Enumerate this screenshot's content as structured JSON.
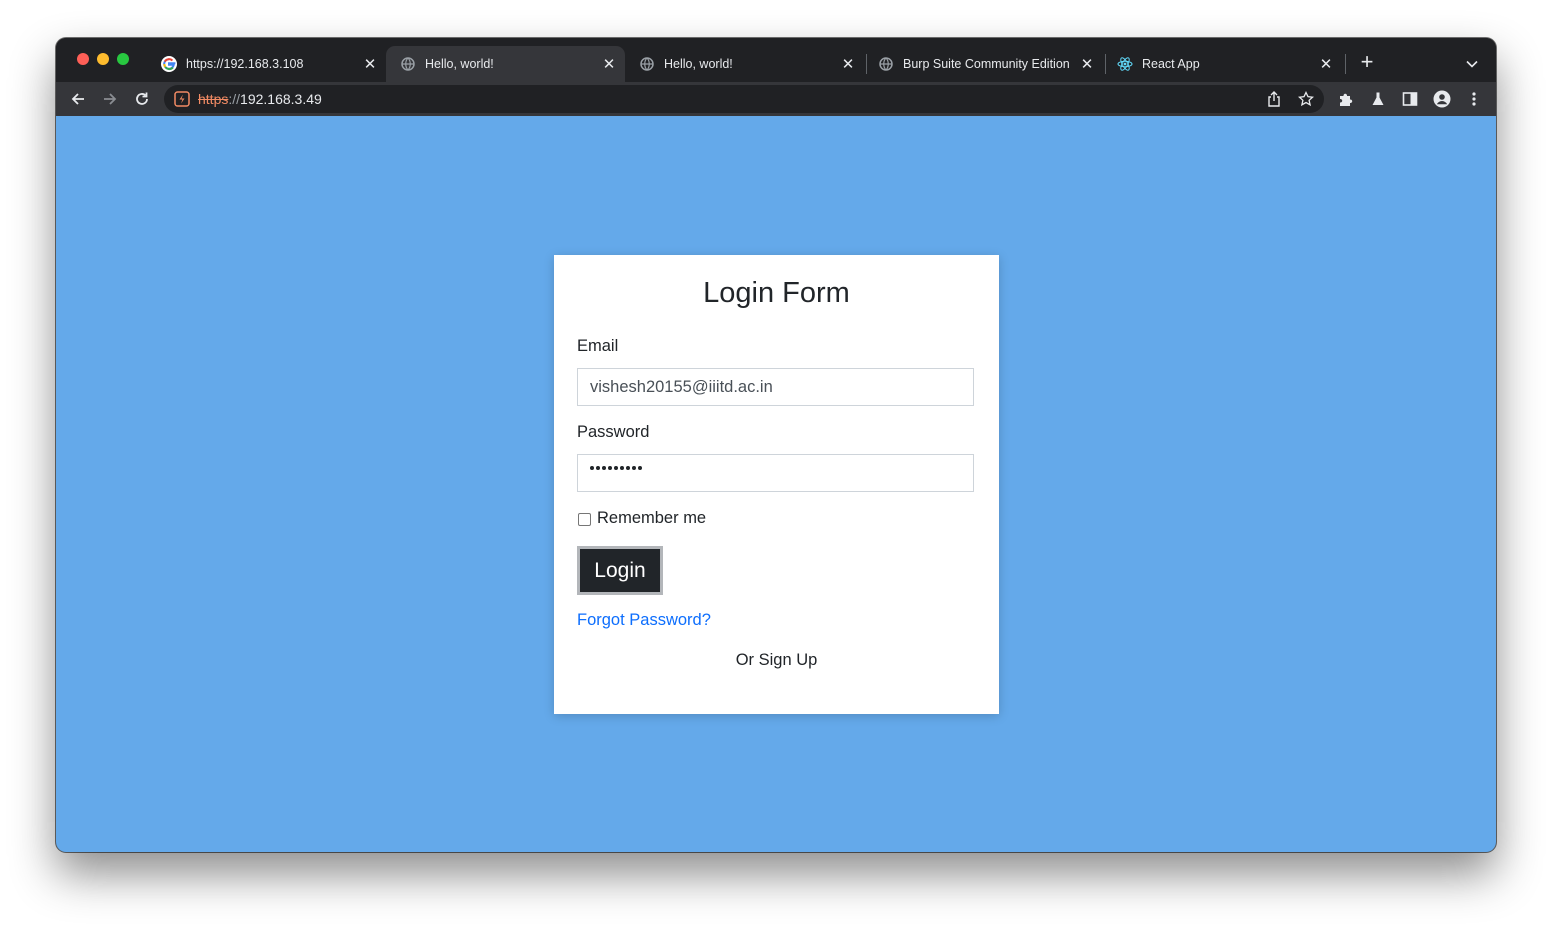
{
  "browser": {
    "tabs": [
      {
        "title": "https://192.168.3.108",
        "icon": "google-icon",
        "active": false
      },
      {
        "title": "Hello, world!",
        "icon": "globe-icon",
        "active": true
      },
      {
        "title": "Hello, world!",
        "icon": "globe-icon",
        "active": false
      },
      {
        "title": "Burp Suite Community Edition",
        "icon": "globe-icon",
        "active": false
      },
      {
        "title": "React App",
        "icon": "react-icon",
        "active": false
      }
    ],
    "address_bar": {
      "scheme": "https",
      "separator": "://",
      "host": "192.168.3.49",
      "security": "not-secure"
    },
    "colors": {
      "accent": "#f28b64",
      "page_background": "#64a9ea"
    }
  },
  "login_form": {
    "title": "Login Form",
    "email_label": "Email",
    "email_value": "vishesh20155@iiitd.ac.in",
    "password_label": "Password",
    "password_masked_length": 9,
    "remember_label": "Remember me",
    "remember_checked": false,
    "login_button": "Login",
    "forgot_link": "Forgot Password?",
    "signup_text": "Or Sign Up"
  }
}
